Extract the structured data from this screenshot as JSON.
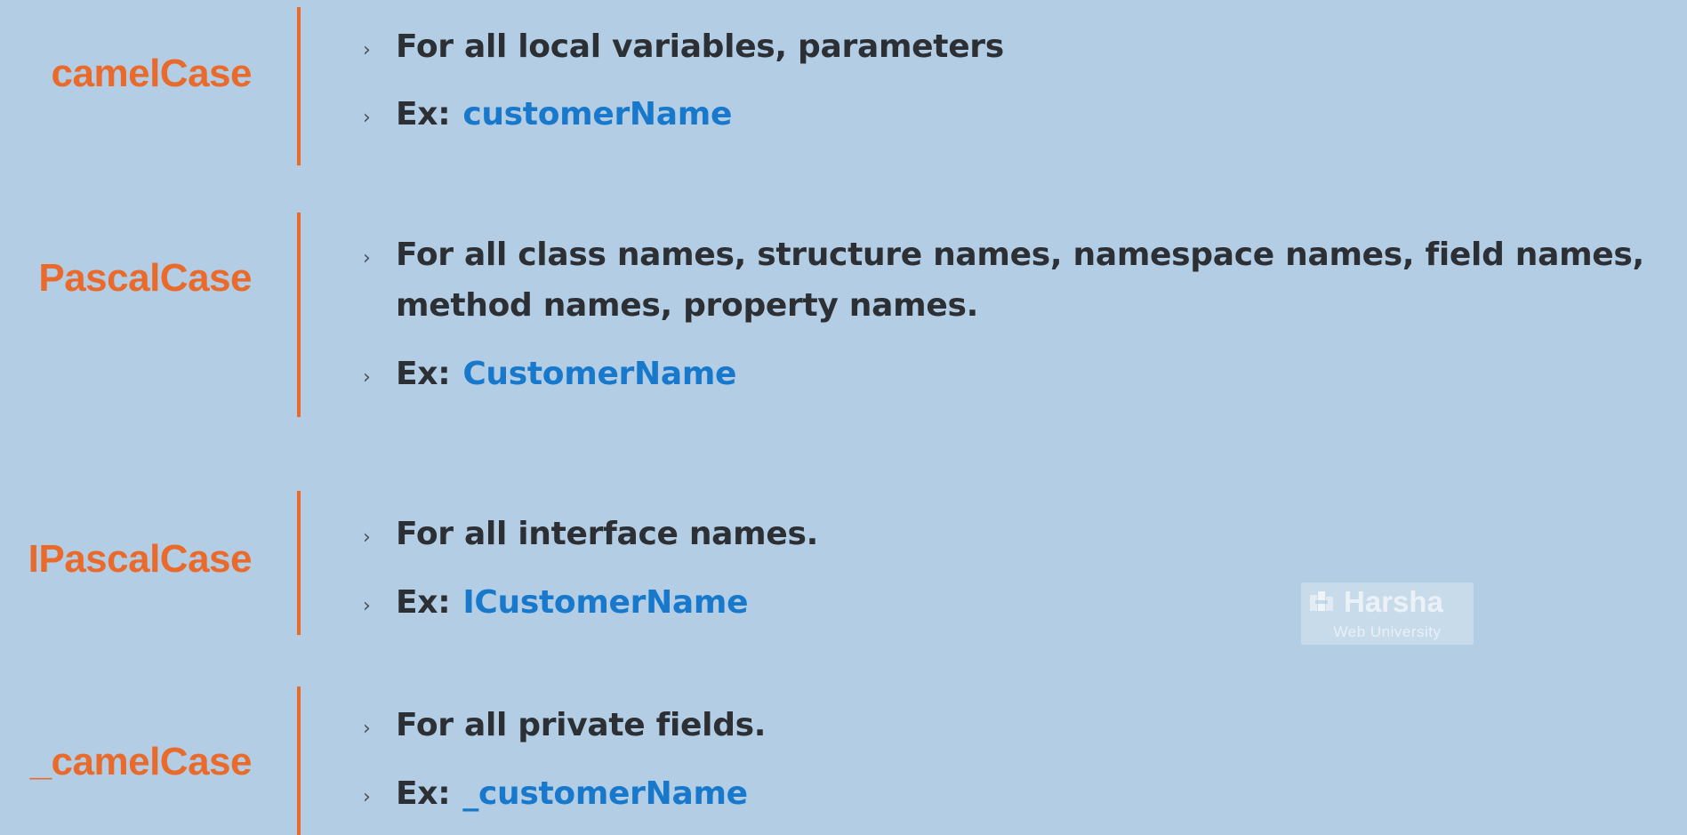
{
  "sections": [
    {
      "name": "camelCase",
      "bullets": [
        "For all local variables, parameters"
      ],
      "example_label": "Ex:",
      "example_value": "customerName"
    },
    {
      "name": "PascalCase",
      "bullets": [
        "For all class names, structure names, namespace names, field names,",
        "method names, property names."
      ],
      "example_label": "Ex:",
      "example_value": "CustomerName"
    },
    {
      "name": "IPascalCase",
      "bullets": [
        "For all interface names."
      ],
      "example_label": "Ex:",
      "example_value": "ICustomerName"
    },
    {
      "name": "_camelCase",
      "bullets": [
        "For all private fields."
      ],
      "example_label": "Ex:",
      "example_value": "_customerName"
    }
  ],
  "bullet_glyph": "›",
  "watermark": {
    "brand": "Harsha",
    "subtitle": "Web University"
  },
  "colors": {
    "background": "#b2cde4",
    "accent": "#ea6a2c",
    "text": "#2c2f34",
    "example": "#1778cc"
  }
}
